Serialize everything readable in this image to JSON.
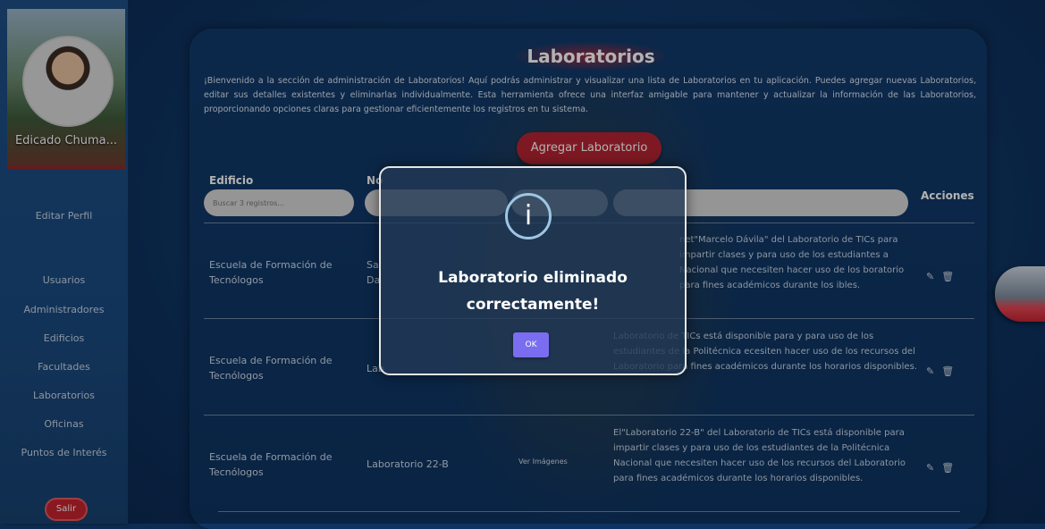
{
  "sidebar": {
    "profile_name": "Edicado Chuma...",
    "items": [
      {
        "label": "Editar Perfil"
      },
      {
        "label": "Usuarios"
      },
      {
        "label": "Administradores"
      },
      {
        "label": "Edificios"
      },
      {
        "label": "Facultades"
      },
      {
        "label": "Laboratorios"
      },
      {
        "label": "Oficinas"
      },
      {
        "label": "Puntos de Interés"
      }
    ],
    "logout_label": "Salir"
  },
  "page": {
    "title": "Laboratorios",
    "intro": "¡Bienvenido a la sección de administración de Laboratorios! Aquí podrás administrar y visualizar una lista de Laboratorios en tu aplicación. Puedes agregar nuevas Laboratorios, editar sus detalles existentes y eliminarlas individualmente. Esta herramienta ofrece una interfaz amigable para mantener y actualizar la información de las Laboratorios, proporcionando opciones claras para gestionar eficientemente los registros en tu sistema.",
    "add_button": "Agregar Laboratorio"
  },
  "table": {
    "headers": {
      "building": "Edificio",
      "name": "No",
      "actions": "Acciones"
    },
    "search_placeholder": "Buscar 3 registros...",
    "rows": [
      {
        "building": "Escuela de Formación de Tecnólogos",
        "name": "Sal",
        "name2": "Da",
        "desc": "net\"Marcelo Dávila\" del Laboratorio de TICs para impartir clases y para uso de los estudiantes a Nacional que necesiten hacer uso de los boratorio para fines académicos durante los ibles."
      },
      {
        "building": "Escuela de Formación de Tecnólogos",
        "name": "Lab",
        "desc": "Laboratorio de TICs está disponible para y para uso de los estudiantes de la Politécnica ecesiten hacer uso de los recursos del Laboratorio para fines académicos durante los horarios disponibles."
      },
      {
        "building": "Escuela de Formación de Tecnólogos",
        "name": "Laboratorio 22-B",
        "images_link": "Ver Imágenes",
        "desc": "El\"Laboratorio 22-B\" del Laboratorio de TICs está disponible para impartir clases y para uso de los estudiantes de la Politécnica Nacional que necesiten hacer uso de los recursos del Laboratorio para fines académicos durante los horarios disponibles."
      }
    ],
    "edit_icon": "✎",
    "delete_icon": "🗑"
  },
  "modal": {
    "icon": "i",
    "message": "Laboratorio eliminado correctamente!",
    "ok_label": "OK"
  }
}
